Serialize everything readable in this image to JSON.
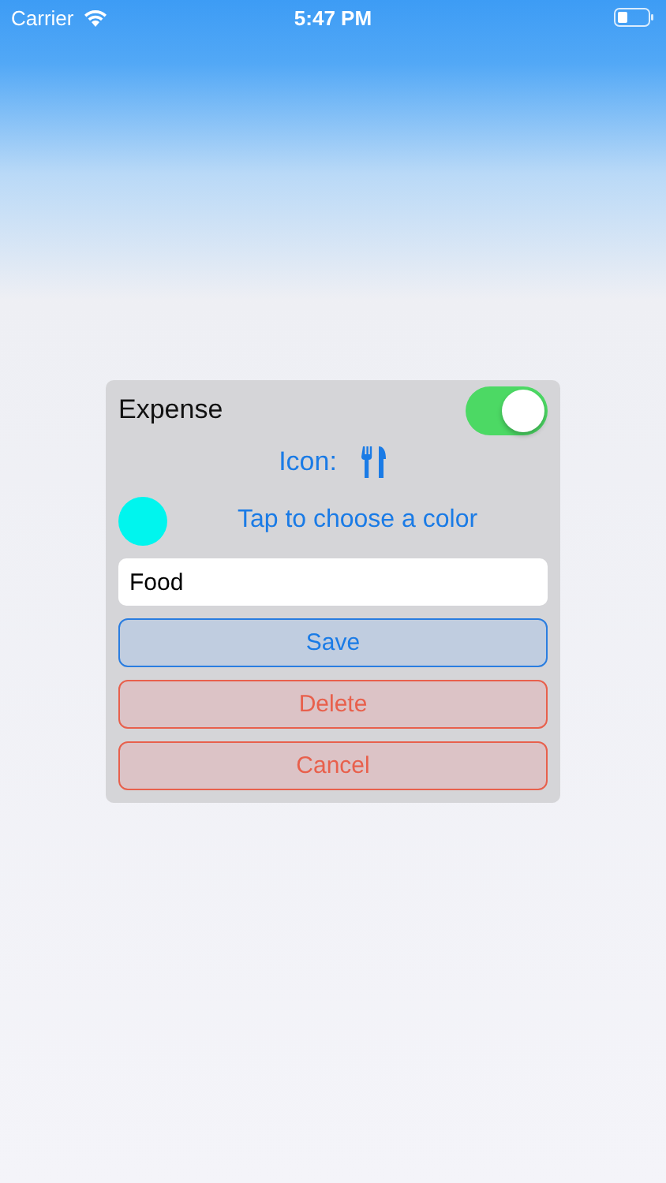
{
  "status_bar": {
    "carrier": "Carrier",
    "time": "5:47 PM"
  },
  "dialog": {
    "title": "Expense",
    "toggle": {
      "on": true
    },
    "icon_label": "Icon:",
    "color_picker": {
      "color": "#00f5ee",
      "label": "Tap to choose a color"
    },
    "name_field": {
      "value": "Food"
    },
    "buttons": [
      {
        "label": "Save",
        "kind": "primary"
      },
      {
        "label": "Delete",
        "kind": "destructive"
      },
      {
        "label": "Cancel",
        "kind": "destructive"
      }
    ]
  }
}
